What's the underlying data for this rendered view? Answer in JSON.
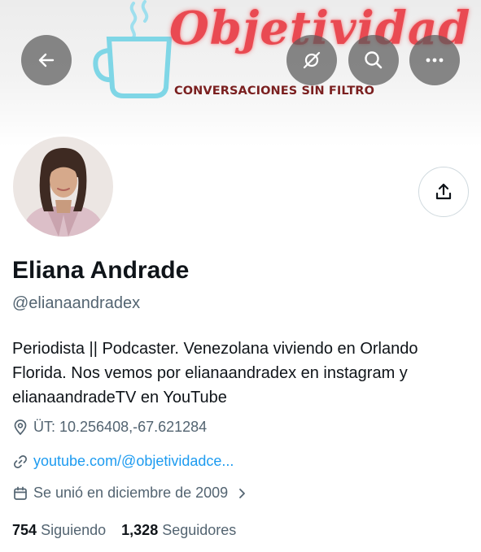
{
  "banner": {
    "brand_text": "Objetividad",
    "subtitle": "CONVERSACIONES SIN FILTRO"
  },
  "nav": {
    "back_icon": "arrow-left-icon",
    "grok_icon": "slash-circle-icon",
    "search_icon": "search-icon",
    "more_icon": "more-horizontal-icon"
  },
  "profile": {
    "name": "Eliana Andrade",
    "handle": "@elianaandradex",
    "bio": "Periodista || Podcaster. Venezolana viviendo en Orlando Florida. Nos vemos por elianaandradex en instagram y elianaandradeTV en YouTube",
    "location": "ÜT: 10.256408,-67.621284",
    "website": "youtube.com/@objetividadce...",
    "joined": "Se unió en diciembre de 2009",
    "following_count": "754",
    "following_label": "Siguiendo",
    "followers_count": "1,328",
    "followers_label": "Seguidores"
  },
  "colors": {
    "link": "#1d9bf0",
    "secondary_text": "#536471",
    "brand_red": "#e94a52",
    "cup_cyan": "#7fd6e6"
  }
}
